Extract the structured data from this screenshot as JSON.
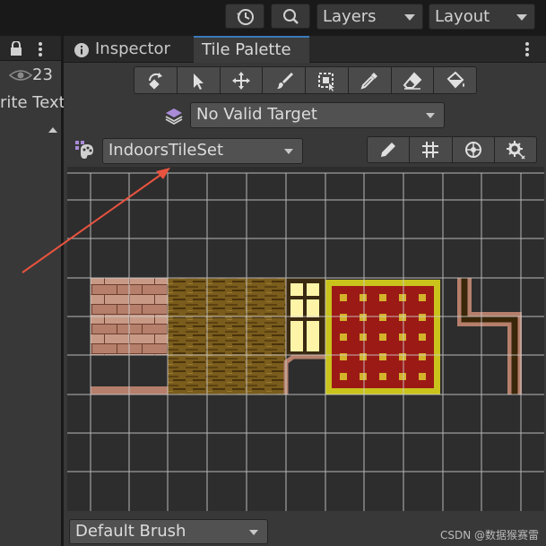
{
  "toolbar": {
    "history_icon": "history-icon",
    "search_icon": "search-icon",
    "layers_label": "Layers",
    "layout_label": "Layout"
  },
  "left_panel": {
    "lock_icon": "lock-icon",
    "menu_icon": "kebab-menu-icon",
    "visibility_count": "23",
    "visible_text": "rite Text"
  },
  "tabs": [
    {
      "label": "Inspector",
      "icon": "info-icon",
      "active": false
    },
    {
      "label": "Tile Palette",
      "active": true
    }
  ],
  "palette_tools": [
    {
      "name": "select-tool",
      "icon": "select-rotate-icon"
    },
    {
      "name": "pointer-tool",
      "icon": "pointer-arrow-icon"
    },
    {
      "name": "move-tool",
      "icon": "move-arrows-icon"
    },
    {
      "name": "paint-tool",
      "icon": "paintbrush-icon"
    },
    {
      "name": "box-fill-tool",
      "icon": "box-fill-icon"
    },
    {
      "name": "picker-tool",
      "icon": "eyedropper-icon"
    },
    {
      "name": "erase-tool",
      "icon": "eraser-icon"
    },
    {
      "name": "fill-tool",
      "icon": "paint-bucket-icon"
    }
  ],
  "active_target": {
    "label": "No Valid Target",
    "icon": "layers-stack-icon"
  },
  "palette_selector": {
    "label": "IndoorsTileSet",
    "icon": "palette-icon"
  },
  "edit_tools": [
    {
      "name": "edit-palette",
      "icon": "pencil-icon"
    },
    {
      "name": "toggle-grid",
      "icon": "grid-icon"
    },
    {
      "name": "gizmos",
      "icon": "gizmo-icon"
    },
    {
      "name": "brush-settings",
      "icon": "gear-icon"
    }
  ],
  "brush": {
    "label": "Default Brush"
  },
  "watermark": "CSDN @数据猴赛雷",
  "colors": {
    "panel": "#383838",
    "palette_bg": "#2d2d2d",
    "grid_line": "#d0d0d0",
    "annotation_arrow": "#e8533f",
    "carpet_red": "#9c1a16",
    "carpet_border": "#c9c31c",
    "window_glow": "#fdf4a8"
  }
}
